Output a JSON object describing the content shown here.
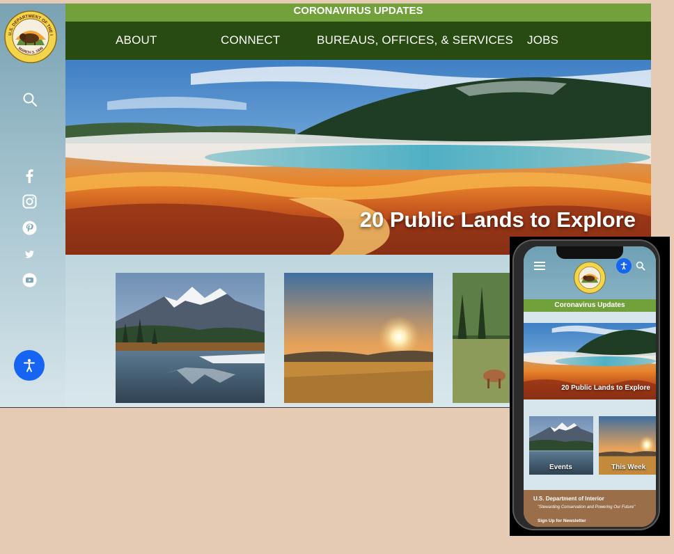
{
  "desktop": {
    "seal": {
      "top_text": "U.S. DEPARTMENT OF THE INTERIOR",
      "bottom_text": "MARCH 3, 1849"
    },
    "banner": {
      "label": "CORONAVIRUS UPDATES"
    },
    "nav": {
      "items": [
        {
          "label": "ABOUT"
        },
        {
          "label": "CONNECT"
        },
        {
          "label": "BUREAUS, OFFICES, & SERVICES"
        },
        {
          "label": "JOBS"
        }
      ]
    },
    "hero": {
      "title": "20 Public Lands to Explore"
    },
    "social": {
      "icons": [
        "facebook-icon",
        "instagram-icon",
        "pinterest-icon",
        "twitter-icon",
        "youtube-icon"
      ]
    }
  },
  "mobile": {
    "banner": {
      "label": "Coronavirus Updates"
    },
    "hero": {
      "title": "20 Public Lands to Explore"
    },
    "cards": [
      {
        "label": "Events"
      },
      {
        "label": "This Week"
      }
    ],
    "footer": {
      "org": "U.S. Department of Interior",
      "tagline": "\"Stewarding Conservation and Powering Our Future\"",
      "newsletter": "Sign Up for Newsletter"
    }
  },
  "colors": {
    "background": "#e6cbb4",
    "banner_green": "#72a13b",
    "nav_green": "#274b10",
    "accessibility_blue": "#1565f2",
    "footer_brown": "#9a6e49"
  }
}
